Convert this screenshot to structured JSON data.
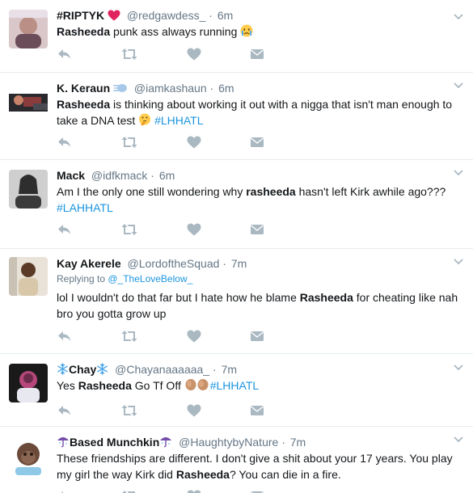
{
  "tweets": [
    {
      "name": "#RIPTYK",
      "handle": "@redgawdess_",
      "dot": "·",
      "time": "6m",
      "text_parts": [
        "Rasheeda",
        " punk ass always running "
      ]
    },
    {
      "name": "K. Keraun",
      "handle": "@iamkashaun",
      "dot": "·",
      "time": "6m",
      "text_parts": [
        "Rasheeda",
        " is thinking about working it out with a nigga that isn't man enough to take a DNA test ",
        "#LHHATL"
      ]
    },
    {
      "name": "Mack",
      "handle": "@idfkmack",
      "dot": "·",
      "time": "6m",
      "text_parts": [
        "Am I the only one still wondering why ",
        "rasheeda",
        " hasn't left Kirk awhile ago??? ",
        "#LAHHATL"
      ]
    },
    {
      "name": "Kay Akerele",
      "handle": "@LordoftheSquad",
      "dot": "·",
      "time": "7m",
      "replying_prefix": "Replying to ",
      "replying_to": "@_TheLoveBelow_",
      "text_parts": [
        "lol I wouldn't do that far but I hate how he blame ",
        "Rasheeda",
        " for cheating like nah bro you gotta grow up"
      ]
    },
    {
      "name": "Chay",
      "handle": "@Chayanaaaaaa_",
      "dot": "·",
      "time": "7m",
      "text_parts": [
        "Yes ",
        "Rasheeda",
        " Go Tf Off ",
        "#LHHATL"
      ]
    },
    {
      "name": "Based Munchkin",
      "handle": "@HaughtybyNature",
      "dot": "·",
      "time": "7m",
      "text_parts": [
        "These friendships are different. I don't give a shit about your 17 years. You play my girl the way Kirk did ",
        "Rasheeda",
        "? You can die in a fire."
      ]
    }
  ],
  "icons": [
    "reply-icon",
    "retweet-icon",
    "like-icon",
    "direct-message-icon",
    "chevron-down-icon"
  ],
  "colors": {
    "text": "#14171a",
    "muted": "#657786",
    "link": "#1b95e0",
    "icon": "#aab8c2",
    "divider": "#e6ecf0"
  }
}
